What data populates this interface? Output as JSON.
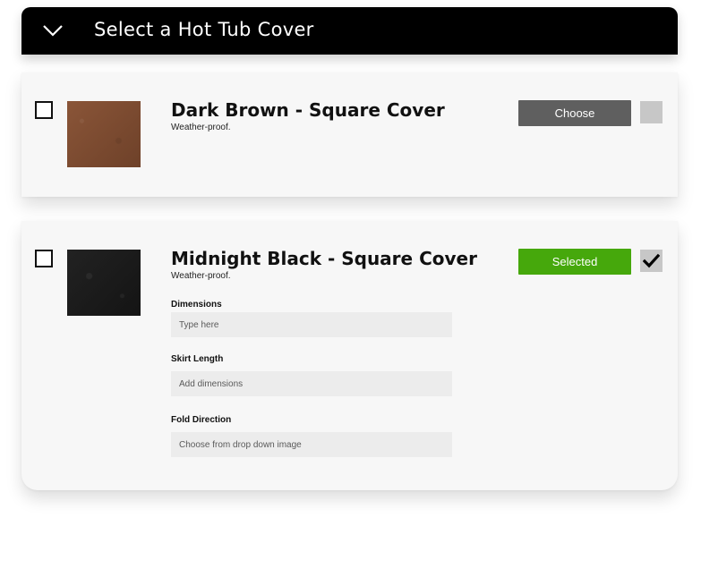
{
  "header": {
    "title": "Select a Hot Tub Cover",
    "toggle_icon": "chevron-down-icon",
    "background": "#000000"
  },
  "options": [
    {
      "name": "Dark Brown - Square Cover",
      "description": "Weather-proof.",
      "button_label": "Choose",
      "selected": false,
      "swatch_color": "#7b4a32",
      "button_color": "#5f5f5f"
    },
    {
      "name": "Midnight Black - Square Cover",
      "description": "Weather-proof.",
      "button_label": "Selected",
      "selected": true,
      "swatch_color": "#1b1b1b",
      "button_color": "#46a80c",
      "fields": [
        {
          "label": "Dimensions",
          "placeholder": "Type here"
        },
        {
          "label": "Skirt Length",
          "placeholder": "Add dimensions"
        },
        {
          "label": "Fold Direction",
          "placeholder": "Choose from drop down image"
        }
      ]
    }
  ]
}
